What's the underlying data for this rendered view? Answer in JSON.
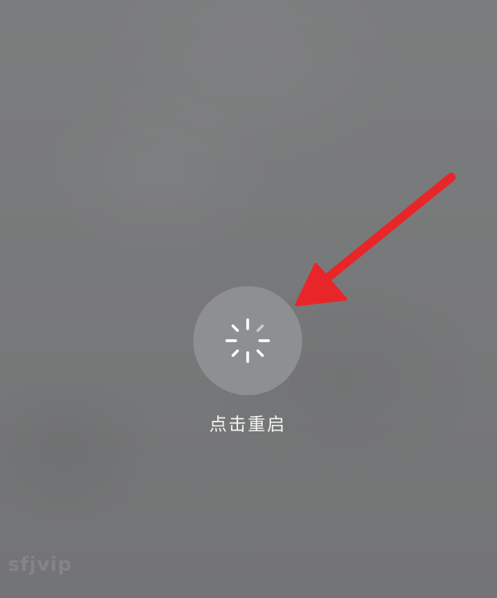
{
  "restart": {
    "label": "点击重启"
  },
  "icons": {
    "spinner": "loading-spinner-icon",
    "arrow": "red-arrow-pointer"
  },
  "colors": {
    "background": "#777879",
    "circle": "#8e8f90",
    "label": "#f4f4f4",
    "arrow": "#e8262a"
  },
  "watermark": {
    "text": "sfjvip"
  }
}
